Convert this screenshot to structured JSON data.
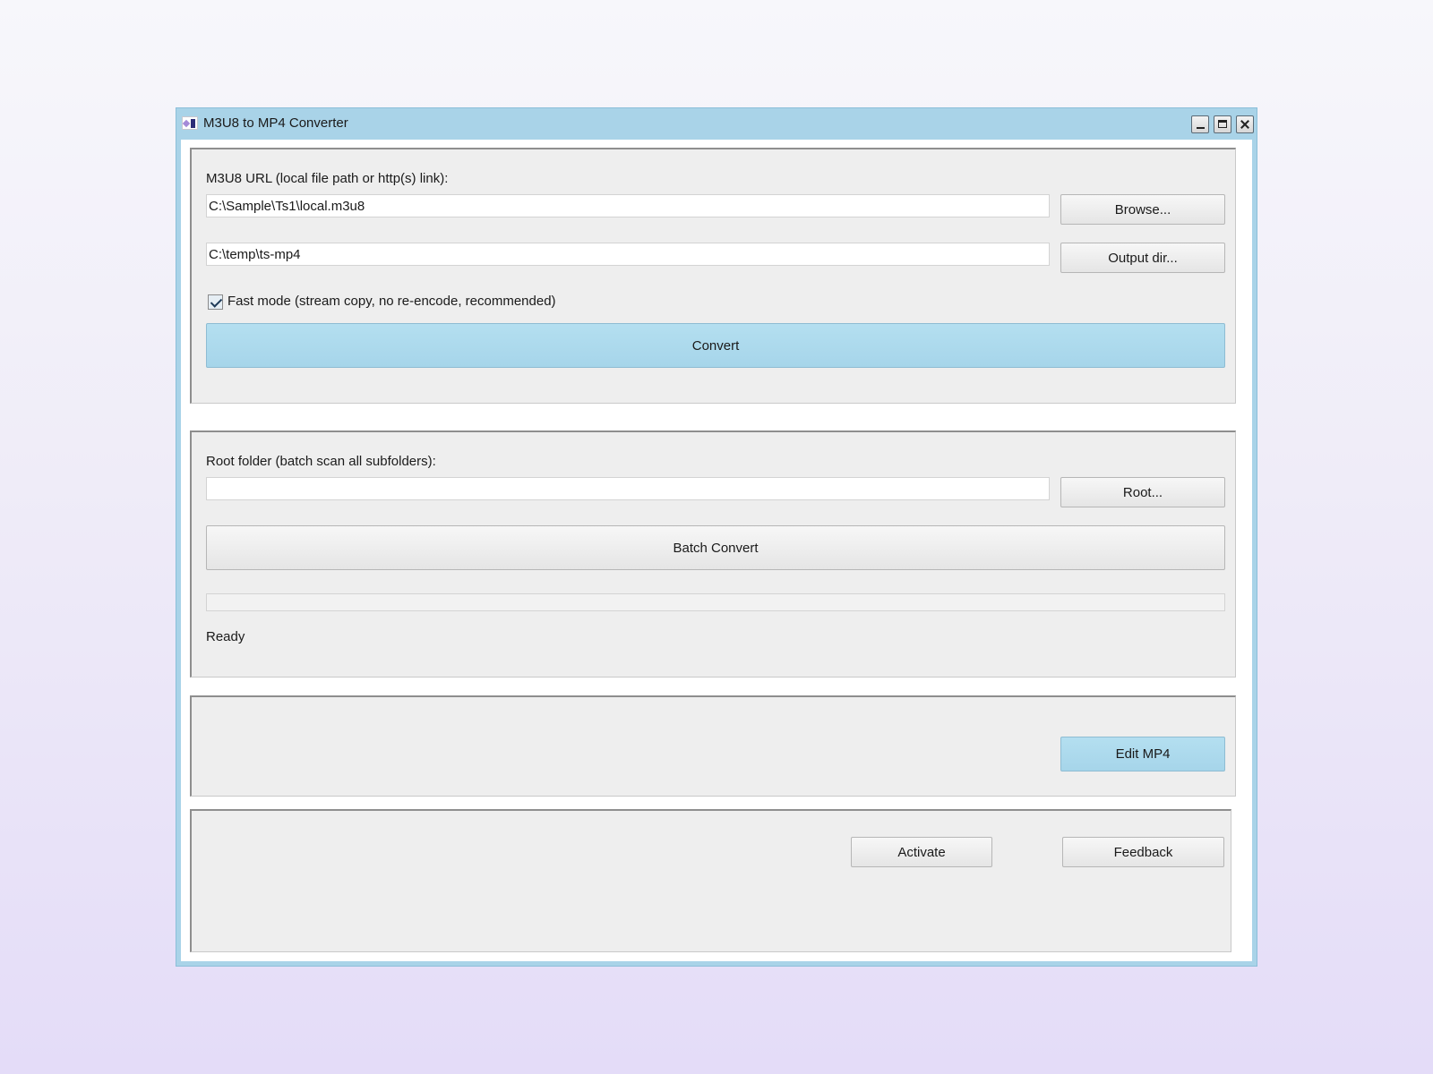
{
  "window": {
    "title": "M3U8 to MP4 Converter",
    "controls": [
      "minimize-icon",
      "maximize-icon",
      "close-icon"
    ]
  },
  "single": {
    "url_label": "M3U8 URL (local file path or http(s) link):",
    "url_value": "C:\\Sample\\Ts1\\local.m3u8",
    "browse_label": "Browse...",
    "output_value": "C:\\temp\\ts-mp4",
    "output_label": "Output dir...",
    "fast_mode_label": "Fast mode (stream copy, no re-encode, recommended)",
    "fast_mode_checked": true,
    "convert_label": "Convert"
  },
  "batch": {
    "root_label": "Root folder (batch scan all subfolders):",
    "root_value": "",
    "root_button_label": "Root...",
    "batch_convert_label": "Batch Convert",
    "progress_fraction": 0,
    "status": "Ready"
  },
  "edit": {
    "edit_label": "Edit MP4"
  },
  "footer": {
    "activate_label": "Activate",
    "feedback_label": "Feedback"
  },
  "colors": {
    "titlebar": "#a9d3e8",
    "primary_button": "#a6d5ea",
    "panel_bg": "#eeeeee"
  }
}
